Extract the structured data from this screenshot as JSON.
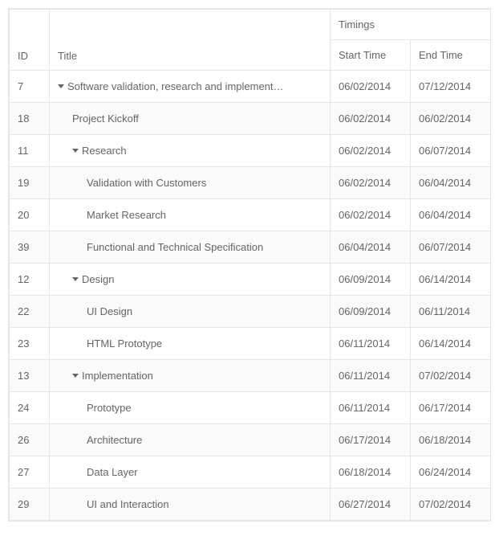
{
  "headers": {
    "id": "ID",
    "title": "Title",
    "timings": "Timings",
    "start": "Start Time",
    "end": "End Time"
  },
  "rows": [
    {
      "id": "7",
      "title": "Software validation, research and implement…",
      "start": "06/02/2014",
      "end": "07/12/2014",
      "indent": 0,
      "expandable": true,
      "alt": false
    },
    {
      "id": "18",
      "title": "Project Kickoff",
      "start": "06/02/2014",
      "end": "06/02/2014",
      "indent": 1,
      "expandable": false,
      "alt": true
    },
    {
      "id": "11",
      "title": "Research",
      "start": "06/02/2014",
      "end": "06/07/2014",
      "indent": 1,
      "expandable": true,
      "alt": false
    },
    {
      "id": "19",
      "title": "Validation with Customers",
      "start": "06/02/2014",
      "end": "06/04/2014",
      "indent": 2,
      "expandable": false,
      "alt": true
    },
    {
      "id": "20",
      "title": "Market Research",
      "start": "06/02/2014",
      "end": "06/04/2014",
      "indent": 2,
      "expandable": false,
      "alt": false
    },
    {
      "id": "39",
      "title": "Functional and Technical Specification",
      "start": "06/04/2014",
      "end": "06/07/2014",
      "indent": 2,
      "expandable": false,
      "alt": true
    },
    {
      "id": "12",
      "title": "Design",
      "start": "06/09/2014",
      "end": "06/14/2014",
      "indent": 1,
      "expandable": true,
      "alt": false
    },
    {
      "id": "22",
      "title": "UI Design",
      "start": "06/09/2014",
      "end": "06/11/2014",
      "indent": 2,
      "expandable": false,
      "alt": true
    },
    {
      "id": "23",
      "title": "HTML Prototype",
      "start": "06/11/2014",
      "end": "06/14/2014",
      "indent": 2,
      "expandable": false,
      "alt": false
    },
    {
      "id": "13",
      "title": "Implementation",
      "start": "06/11/2014",
      "end": "07/02/2014",
      "indent": 1,
      "expandable": true,
      "alt": true
    },
    {
      "id": "24",
      "title": "Prototype",
      "start": "06/11/2014",
      "end": "06/17/2014",
      "indent": 2,
      "expandable": false,
      "alt": false
    },
    {
      "id": "26",
      "title": "Architecture",
      "start": "06/17/2014",
      "end": "06/18/2014",
      "indent": 2,
      "expandable": false,
      "alt": true
    },
    {
      "id": "27",
      "title": "Data Layer",
      "start": "06/18/2014",
      "end": "06/24/2014",
      "indent": 2,
      "expandable": false,
      "alt": false
    },
    {
      "id": "29",
      "title": "UI and Interaction",
      "start": "06/27/2014",
      "end": "07/02/2014",
      "indent": 2,
      "expandable": false,
      "alt": true
    }
  ]
}
